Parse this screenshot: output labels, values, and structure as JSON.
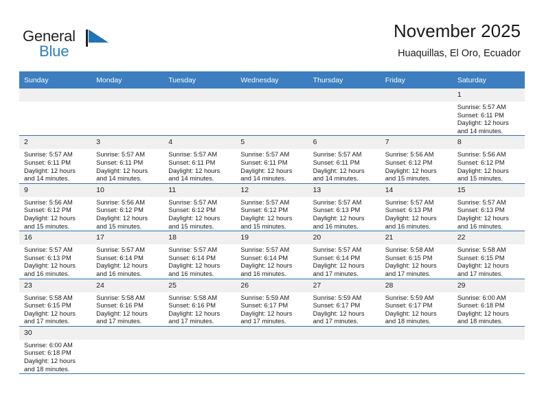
{
  "brand": {
    "name_part1": "General",
    "name_part2": "Blue",
    "flag_icon": "blue-triangle-flag-icon",
    "accent_color": "#2980c4"
  },
  "header": {
    "title": "November 2025",
    "subtitle": "Huaquillas, El Oro, Ecuador"
  },
  "colors": {
    "header_blue": "#3c7ebf",
    "row_divider_blue": "#2f6fad",
    "daynum_band": "#f0f0f0"
  },
  "weekday_headers": [
    "Sunday",
    "Monday",
    "Tuesday",
    "Wednesday",
    "Thursday",
    "Friday",
    "Saturday"
  ],
  "labels": {
    "sunrise_prefix": "Sunrise:",
    "sunset_prefix": "Sunset:",
    "daylight_prefix": "Daylight:"
  },
  "weeks": [
    [
      {
        "day": "",
        "empty": true
      },
      {
        "day": "",
        "empty": true
      },
      {
        "day": "",
        "empty": true
      },
      {
        "day": "",
        "empty": true
      },
      {
        "day": "",
        "empty": true
      },
      {
        "day": "",
        "empty": true
      },
      {
        "day": "1",
        "sunrise": "Sunrise: 5:57 AM",
        "sunset": "Sunset: 6:11 PM",
        "daylight_line1": "Daylight: 12 hours",
        "daylight_line2": "and 14 minutes."
      }
    ],
    [
      {
        "day": "2",
        "sunrise": "Sunrise: 5:57 AM",
        "sunset": "Sunset: 6:11 PM",
        "daylight_line1": "Daylight: 12 hours",
        "daylight_line2": "and 14 minutes."
      },
      {
        "day": "3",
        "sunrise": "Sunrise: 5:57 AM",
        "sunset": "Sunset: 6:11 PM",
        "daylight_line1": "Daylight: 12 hours",
        "daylight_line2": "and 14 minutes."
      },
      {
        "day": "4",
        "sunrise": "Sunrise: 5:57 AM",
        "sunset": "Sunset: 6:11 PM",
        "daylight_line1": "Daylight: 12 hours",
        "daylight_line2": "and 14 minutes."
      },
      {
        "day": "5",
        "sunrise": "Sunrise: 5:57 AM",
        "sunset": "Sunset: 6:11 PM",
        "daylight_line1": "Daylight: 12 hours",
        "daylight_line2": "and 14 minutes."
      },
      {
        "day": "6",
        "sunrise": "Sunrise: 5:57 AM",
        "sunset": "Sunset: 6:11 PM",
        "daylight_line1": "Daylight: 12 hours",
        "daylight_line2": "and 14 minutes."
      },
      {
        "day": "7",
        "sunrise": "Sunrise: 5:56 AM",
        "sunset": "Sunset: 6:12 PM",
        "daylight_line1": "Daylight: 12 hours",
        "daylight_line2": "and 15 minutes."
      },
      {
        "day": "8",
        "sunrise": "Sunrise: 5:56 AM",
        "sunset": "Sunset: 6:12 PM",
        "daylight_line1": "Daylight: 12 hours",
        "daylight_line2": "and 15 minutes."
      }
    ],
    [
      {
        "day": "9",
        "sunrise": "Sunrise: 5:56 AM",
        "sunset": "Sunset: 6:12 PM",
        "daylight_line1": "Daylight: 12 hours",
        "daylight_line2": "and 15 minutes."
      },
      {
        "day": "10",
        "sunrise": "Sunrise: 5:56 AM",
        "sunset": "Sunset: 6:12 PM",
        "daylight_line1": "Daylight: 12 hours",
        "daylight_line2": "and 15 minutes."
      },
      {
        "day": "11",
        "sunrise": "Sunrise: 5:57 AM",
        "sunset": "Sunset: 6:12 PM",
        "daylight_line1": "Daylight: 12 hours",
        "daylight_line2": "and 15 minutes."
      },
      {
        "day": "12",
        "sunrise": "Sunrise: 5:57 AM",
        "sunset": "Sunset: 6:12 PM",
        "daylight_line1": "Daylight: 12 hours",
        "daylight_line2": "and 15 minutes."
      },
      {
        "day": "13",
        "sunrise": "Sunrise: 5:57 AM",
        "sunset": "Sunset: 6:13 PM",
        "daylight_line1": "Daylight: 12 hours",
        "daylight_line2": "and 16 minutes."
      },
      {
        "day": "14",
        "sunrise": "Sunrise: 5:57 AM",
        "sunset": "Sunset: 6:13 PM",
        "daylight_line1": "Daylight: 12 hours",
        "daylight_line2": "and 16 minutes."
      },
      {
        "day": "15",
        "sunrise": "Sunrise: 5:57 AM",
        "sunset": "Sunset: 6:13 PM",
        "daylight_line1": "Daylight: 12 hours",
        "daylight_line2": "and 16 minutes."
      }
    ],
    [
      {
        "day": "16",
        "sunrise": "Sunrise: 5:57 AM",
        "sunset": "Sunset: 6:13 PM",
        "daylight_line1": "Daylight: 12 hours",
        "daylight_line2": "and 16 minutes."
      },
      {
        "day": "17",
        "sunrise": "Sunrise: 5:57 AM",
        "sunset": "Sunset: 6:14 PM",
        "daylight_line1": "Daylight: 12 hours",
        "daylight_line2": "and 16 minutes."
      },
      {
        "day": "18",
        "sunrise": "Sunrise: 5:57 AM",
        "sunset": "Sunset: 6:14 PM",
        "daylight_line1": "Daylight: 12 hours",
        "daylight_line2": "and 16 minutes."
      },
      {
        "day": "19",
        "sunrise": "Sunrise: 5:57 AM",
        "sunset": "Sunset: 6:14 PM",
        "daylight_line1": "Daylight: 12 hours",
        "daylight_line2": "and 16 minutes."
      },
      {
        "day": "20",
        "sunrise": "Sunrise: 5:57 AM",
        "sunset": "Sunset: 6:14 PM",
        "daylight_line1": "Daylight: 12 hours",
        "daylight_line2": "and 17 minutes."
      },
      {
        "day": "21",
        "sunrise": "Sunrise: 5:58 AM",
        "sunset": "Sunset: 6:15 PM",
        "daylight_line1": "Daylight: 12 hours",
        "daylight_line2": "and 17 minutes."
      },
      {
        "day": "22",
        "sunrise": "Sunrise: 5:58 AM",
        "sunset": "Sunset: 6:15 PM",
        "daylight_line1": "Daylight: 12 hours",
        "daylight_line2": "and 17 minutes."
      }
    ],
    [
      {
        "day": "23",
        "sunrise": "Sunrise: 5:58 AM",
        "sunset": "Sunset: 6:15 PM",
        "daylight_line1": "Daylight: 12 hours",
        "daylight_line2": "and 17 minutes."
      },
      {
        "day": "24",
        "sunrise": "Sunrise: 5:58 AM",
        "sunset": "Sunset: 6:16 PM",
        "daylight_line1": "Daylight: 12 hours",
        "daylight_line2": "and 17 minutes."
      },
      {
        "day": "25",
        "sunrise": "Sunrise: 5:58 AM",
        "sunset": "Sunset: 6:16 PM",
        "daylight_line1": "Daylight: 12 hours",
        "daylight_line2": "and 17 minutes."
      },
      {
        "day": "26",
        "sunrise": "Sunrise: 5:59 AM",
        "sunset": "Sunset: 6:17 PM",
        "daylight_line1": "Daylight: 12 hours",
        "daylight_line2": "and 17 minutes."
      },
      {
        "day": "27",
        "sunrise": "Sunrise: 5:59 AM",
        "sunset": "Sunset: 6:17 PM",
        "daylight_line1": "Daylight: 12 hours",
        "daylight_line2": "and 17 minutes."
      },
      {
        "day": "28",
        "sunrise": "Sunrise: 5:59 AM",
        "sunset": "Sunset: 6:17 PM",
        "daylight_line1": "Daylight: 12 hours",
        "daylight_line2": "and 18 minutes."
      },
      {
        "day": "29",
        "sunrise": "Sunrise: 6:00 AM",
        "sunset": "Sunset: 6:18 PM",
        "daylight_line1": "Daylight: 12 hours",
        "daylight_line2": "and 18 minutes."
      }
    ],
    [
      {
        "day": "30",
        "sunrise": "Sunrise: 6:00 AM",
        "sunset": "Sunset: 6:18 PM",
        "daylight_line1": "Daylight: 12 hours",
        "daylight_line2": "and 18 minutes."
      },
      {
        "day": "",
        "empty": true
      },
      {
        "day": "",
        "empty": true
      },
      {
        "day": "",
        "empty": true
      },
      {
        "day": "",
        "empty": true
      },
      {
        "day": "",
        "empty": true
      },
      {
        "day": "",
        "empty": true
      }
    ]
  ]
}
